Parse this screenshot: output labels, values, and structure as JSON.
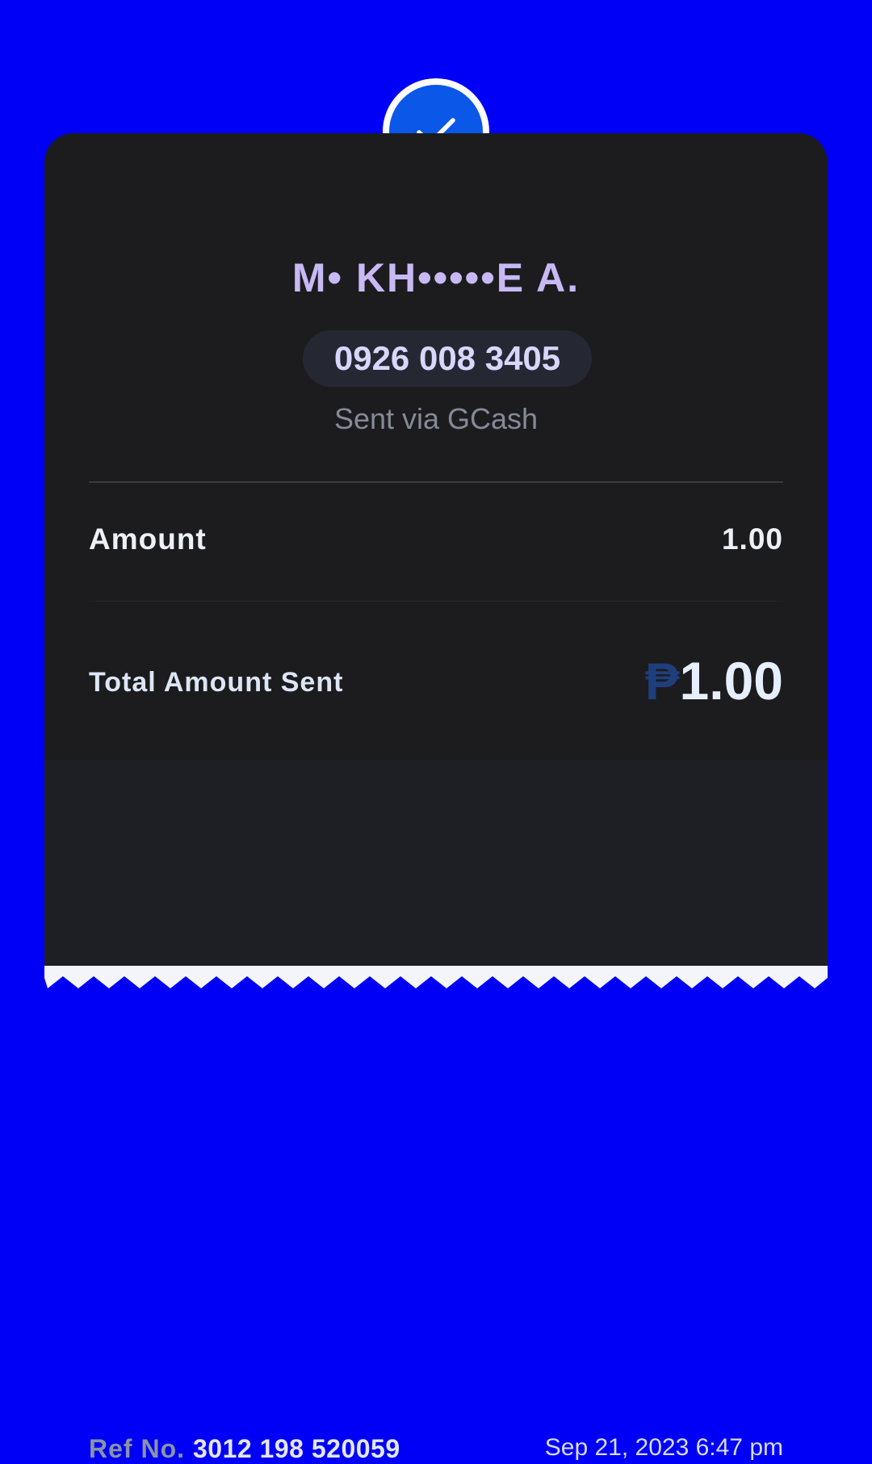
{
  "receipt": {
    "recipient_name": "M• KH•••••E A.",
    "phone_number": "0926 008 3405",
    "sent_via": "Sent via GCash",
    "amount_label": "Amount",
    "amount_value": "1.00",
    "total_label": "Total Amount Sent",
    "currency_symbol": "₱",
    "total_value": "1.00",
    "ref_label": "Ref No.",
    "ref_number": "3012 198 520059",
    "datetime": "Sep 21, 2023 6:47 pm"
  },
  "icons": {
    "status": "checkmark-icon"
  },
  "colors": {
    "background": "#0000f6",
    "card": "#1c1c1e",
    "card_footer": "#1e1f24",
    "accent_blue": "#0b57e8",
    "name_purple": "#c8b9f5",
    "peso_blue": "#1f3e7d"
  }
}
